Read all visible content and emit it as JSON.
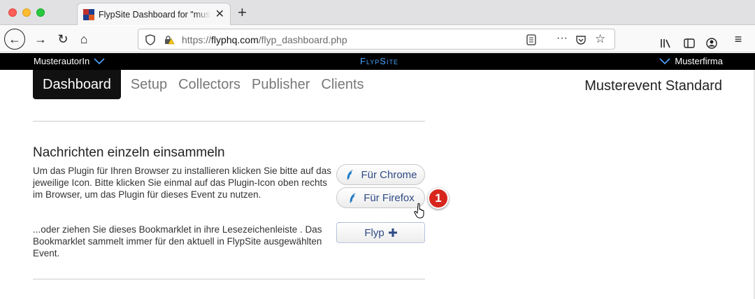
{
  "browser": {
    "tab_title": "FlypSite Dashboard for \"musterautorin\"",
    "url_host": "flyphq.com",
    "url_prefix": "https://",
    "url_path": "/flyp_dashboard.php"
  },
  "site": {
    "user": "MusterautorIn",
    "logo": "FlypSite",
    "company": "Musterfirma"
  },
  "nav": {
    "active": "Dashboard",
    "items": [
      "Setup",
      "Collectors",
      "Publisher",
      "Clients"
    ],
    "event": "Musterevent Standard"
  },
  "collect": {
    "title": "Nachrichten einzeln einsammeln",
    "plugin_text": "Um das Plugin für Ihren Browser zu installieren klicken Sie bitte auf das jeweilige Icon. Bitte klicken Sie einmal auf das Plugin-Icon oben rechts im Browser, um das Plugin für dieses Event zu nutzen.",
    "chrome_label": "Für Chrome",
    "firefox_label": "Für Firefox",
    "bookmarklet_text": "...oder ziehen Sie dieses Bookmarklet in ihre Lesezeichenleiste . Das Bookmarklet sammelt immer für den aktuell in FlypSite ausgewählten Event.",
    "flyp_label": "Flyp"
  },
  "annotation": {
    "step": "1"
  },
  "colors": {
    "accent": "#4da3ff",
    "badge": "#d8261c",
    "button_text": "#2f4a86"
  }
}
